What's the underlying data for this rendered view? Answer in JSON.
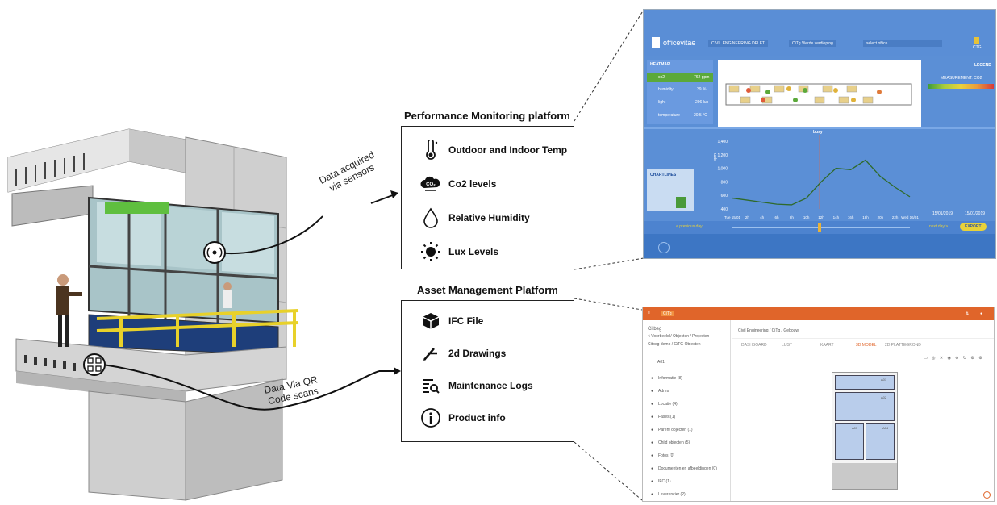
{
  "annotations": {
    "sensors_line1": "Data acquired",
    "sensors_line2": "via sensors",
    "qr_line1": "Data Via QR",
    "qr_line2": "Code scans"
  },
  "performance": {
    "title": "Performance Monitoring platform",
    "items": [
      {
        "label": "Outdoor and Indoor Temp",
        "icon": "thermometer-icon"
      },
      {
        "label": "Co2 levels",
        "icon": "co2-cloud-icon"
      },
      {
        "label": "Relative Humidity",
        "icon": "droplet-icon"
      },
      {
        "label": "Lux Levels",
        "icon": "sun-icon"
      }
    ]
  },
  "asset": {
    "title": "Asset Management Platform",
    "items": [
      {
        "label": "IFC File",
        "icon": "cube-icon"
      },
      {
        "label": "2d Drawings",
        "icon": "drawing-icon"
      },
      {
        "label": "Maintenance Logs",
        "icon": "log-search-icon"
      },
      {
        "label": "Product info",
        "icon": "info-icon"
      }
    ]
  },
  "officevitae": {
    "logo": "officevitae",
    "building_select": "CIVIL ENGINEERING DELFT",
    "floor_select": "CiTg  Vierde verdieping",
    "office_select": "select office",
    "user": "CTG",
    "heatmap_title": "HEATMAP",
    "heatmap_rows": [
      {
        "name": "co2",
        "value": "762 ppm"
      },
      {
        "name": "humidity",
        "value": "39 %"
      },
      {
        "name": "light",
        "value": "296 lux"
      },
      {
        "name": "temperature",
        "value": "20.5 °C"
      }
    ],
    "legend_title": "LEGEND",
    "legend_measurement": "MEASUREMENT: CO2",
    "chartlines_title": "CHARTLINES",
    "busy_label": "busy",
    "y_unit": "ppm",
    "y_ticks": [
      "1,400",
      "1,200",
      "1,000",
      "800",
      "600",
      "400"
    ],
    "x_ticks": [
      "Tue 15/01",
      "2h",
      "4h",
      "6h",
      "8h",
      "10h",
      "12h",
      "14h",
      "16h",
      "18h",
      "20h",
      "22h",
      "Wed 16/01"
    ],
    "date_from": "15/01/2019",
    "date_to": "15/01/2019",
    "prev_day": "< previous day",
    "next_day": "next day >",
    "export": "EXPORT"
  },
  "asset_app": {
    "header_tab": "CiTg",
    "breadcrumb": "Civil Engineering / CiTg / Gebouw",
    "sidebar_title": "Citbeg",
    "sidebar_path": "< Voorbeeld / Objecten / Projecten",
    "sidebar_sub": "Citbeg demo / CiTG Objecten",
    "node": "A01",
    "tabs": [
      "DASHBOARD",
      "LIJST",
      "KAART",
      "3D MODEL",
      "2D PLATTEGROND"
    ],
    "menu": [
      "Informatie (8)",
      "Adres",
      "Locatie (4)",
      "Fases (1)",
      "Parent objecten (1)",
      "Child objecten (5)",
      "Fotos (0)",
      "Documenten en afbeeldingen (0)",
      "IFC (1)",
      "Leverancier (2)"
    ],
    "rooms": [
      "A01",
      "A02",
      "A03",
      "A04"
    ]
  },
  "chart_data": {
    "type": "line",
    "title": "",
    "ylabel": "ppm",
    "xlabel": "",
    "ylim": [
      400,
      1400
    ],
    "x": [
      "Tue 15/01",
      "2h",
      "4h",
      "6h",
      "8h",
      "10h",
      "12h",
      "14h",
      "16h",
      "18h",
      "20h",
      "22h",
      "Wed 16/01"
    ],
    "series": [
      {
        "values": [
          560,
          530,
          500,
          470,
          460,
          560,
          800,
          1000,
          980,
          1120,
          880,
          720,
          580
        ]
      }
    ]
  }
}
